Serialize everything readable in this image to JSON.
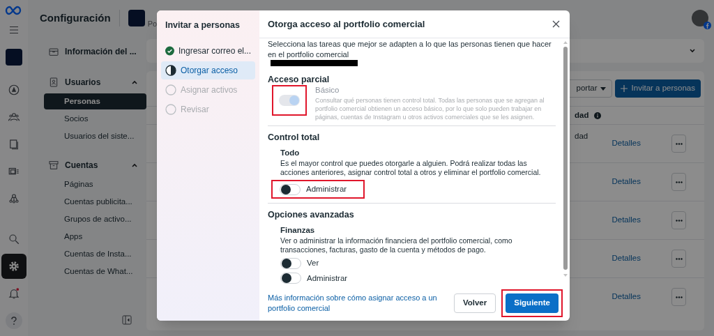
{
  "rail_items": [
    {
      "kind": "menu",
      "selected": false
    },
    {
      "kind": "avatar",
      "selected": false
    },
    {
      "kind": "compass",
      "selected": false
    },
    {
      "kind": "people",
      "selected": false
    },
    {
      "kind": "pages",
      "selected": false
    },
    {
      "kind": "media",
      "selected": false
    },
    {
      "kind": "network",
      "selected": false
    }
  ],
  "rail_bottom": [
    {
      "kind": "search",
      "selected": false
    },
    {
      "kind": "settings",
      "selected": true
    },
    {
      "kind": "bell",
      "selected": false
    },
    {
      "kind": "help",
      "selected": false
    }
  ],
  "page_title": "Configuración",
  "business": {
    "name_fragment": "Po"
  },
  "sidebar": [
    {
      "label": "Información del ...",
      "kind": "info"
    },
    {
      "label": "Usuarios",
      "kind": "users",
      "expanded": true,
      "children": [
        {
          "label": "Personas",
          "selected": true
        },
        {
          "label": "Socios",
          "selected": false
        },
        {
          "label": "Usuarios del siste...",
          "selected": false
        }
      ]
    },
    {
      "label": "Cuentas",
      "kind": "accounts",
      "expanded": true,
      "children": [
        {
          "label": "Páginas",
          "selected": false
        },
        {
          "label": "Cuentas publicita...",
          "selected": false
        },
        {
          "label": "Grupos de activo...",
          "selected": false
        },
        {
          "label": "Apps",
          "selected": false
        },
        {
          "label": "Cuentas de Insta...",
          "selected": false
        },
        {
          "label": "Cuentas de What...",
          "selected": false
        }
      ]
    }
  ],
  "table": {
    "export_label": "portar",
    "invite_label": "Invitar a personas",
    "column_header": "dad",
    "rows": [
      {
        "cell": "dad",
        "link": "Detalles"
      },
      {
        "link": "Detalles"
      },
      {
        "link": "Detalles"
      },
      {
        "link": "Detalles"
      },
      {
        "link": "Detalles"
      }
    ]
  },
  "dialog": {
    "steps_title": "Invitar a personas",
    "steps": [
      {
        "label": "Ingresar correo el...",
        "kind": "done",
        "selected": false
      },
      {
        "label": "Otorgar acceso",
        "kind": "current",
        "selected": true
      },
      {
        "label": "Asignar activos",
        "kind": "pending",
        "selected": false
      },
      {
        "label": "Revisar",
        "kind": "pending",
        "selected": false
      }
    ],
    "title": "Otorga acceso al portfolio comercial",
    "intro": "Selecciona las tareas que mejor se adapten a lo que las personas tienen que hacer en el portfolio comercial",
    "sections": [
      {
        "title": "Acceso parcial",
        "options": [
          {
            "kind": "inline",
            "title": "Básico",
            "description": "Consultar qué personas tienen control total. Todas las personas que se agregan al portfolio comercial obtienen un acceso básico, por lo que solo pueden trabajar en páginas, cuentas de Instagram u otros activos comerciales que se les asignen.",
            "toggles": [
              {
                "on": true,
                "disabled": true,
                "highlighted": true
              }
            ]
          }
        ]
      },
      {
        "title": "Control total",
        "options": [
          {
            "kind": "stacked",
            "title": "Todo",
            "description": "Es el mayor control que puedes otorgarle a alguien. Podrá realizar todas las acciones anteriores, asignar control total a otros y eliminar el portfolio comercial.",
            "toggles": [
              {
                "label": "Administrar",
                "on": false,
                "disabled": false,
                "highlighted": true
              }
            ]
          }
        ]
      },
      {
        "title": "Opciones avanzadas",
        "options": [
          {
            "kind": "stacked",
            "title": "Finanzas",
            "description": "Ver o administrar la información financiera del portfolio comercial, como transacciones, facturas, gasto de la cuenta y métodos de pago.",
            "toggles": [
              {
                "label": "Ver",
                "on": false,
                "disabled": false,
                "highlighted": false
              },
              {
                "label": "Administrar",
                "on": false,
                "disabled": false,
                "highlighted": false
              }
            ]
          }
        ]
      }
    ],
    "help_link": "Más información sobre cómo asignar acceso a un portfolio comercial",
    "back_label": "Volver",
    "next_label": "Siguiente",
    "next_highlighted": true
  }
}
